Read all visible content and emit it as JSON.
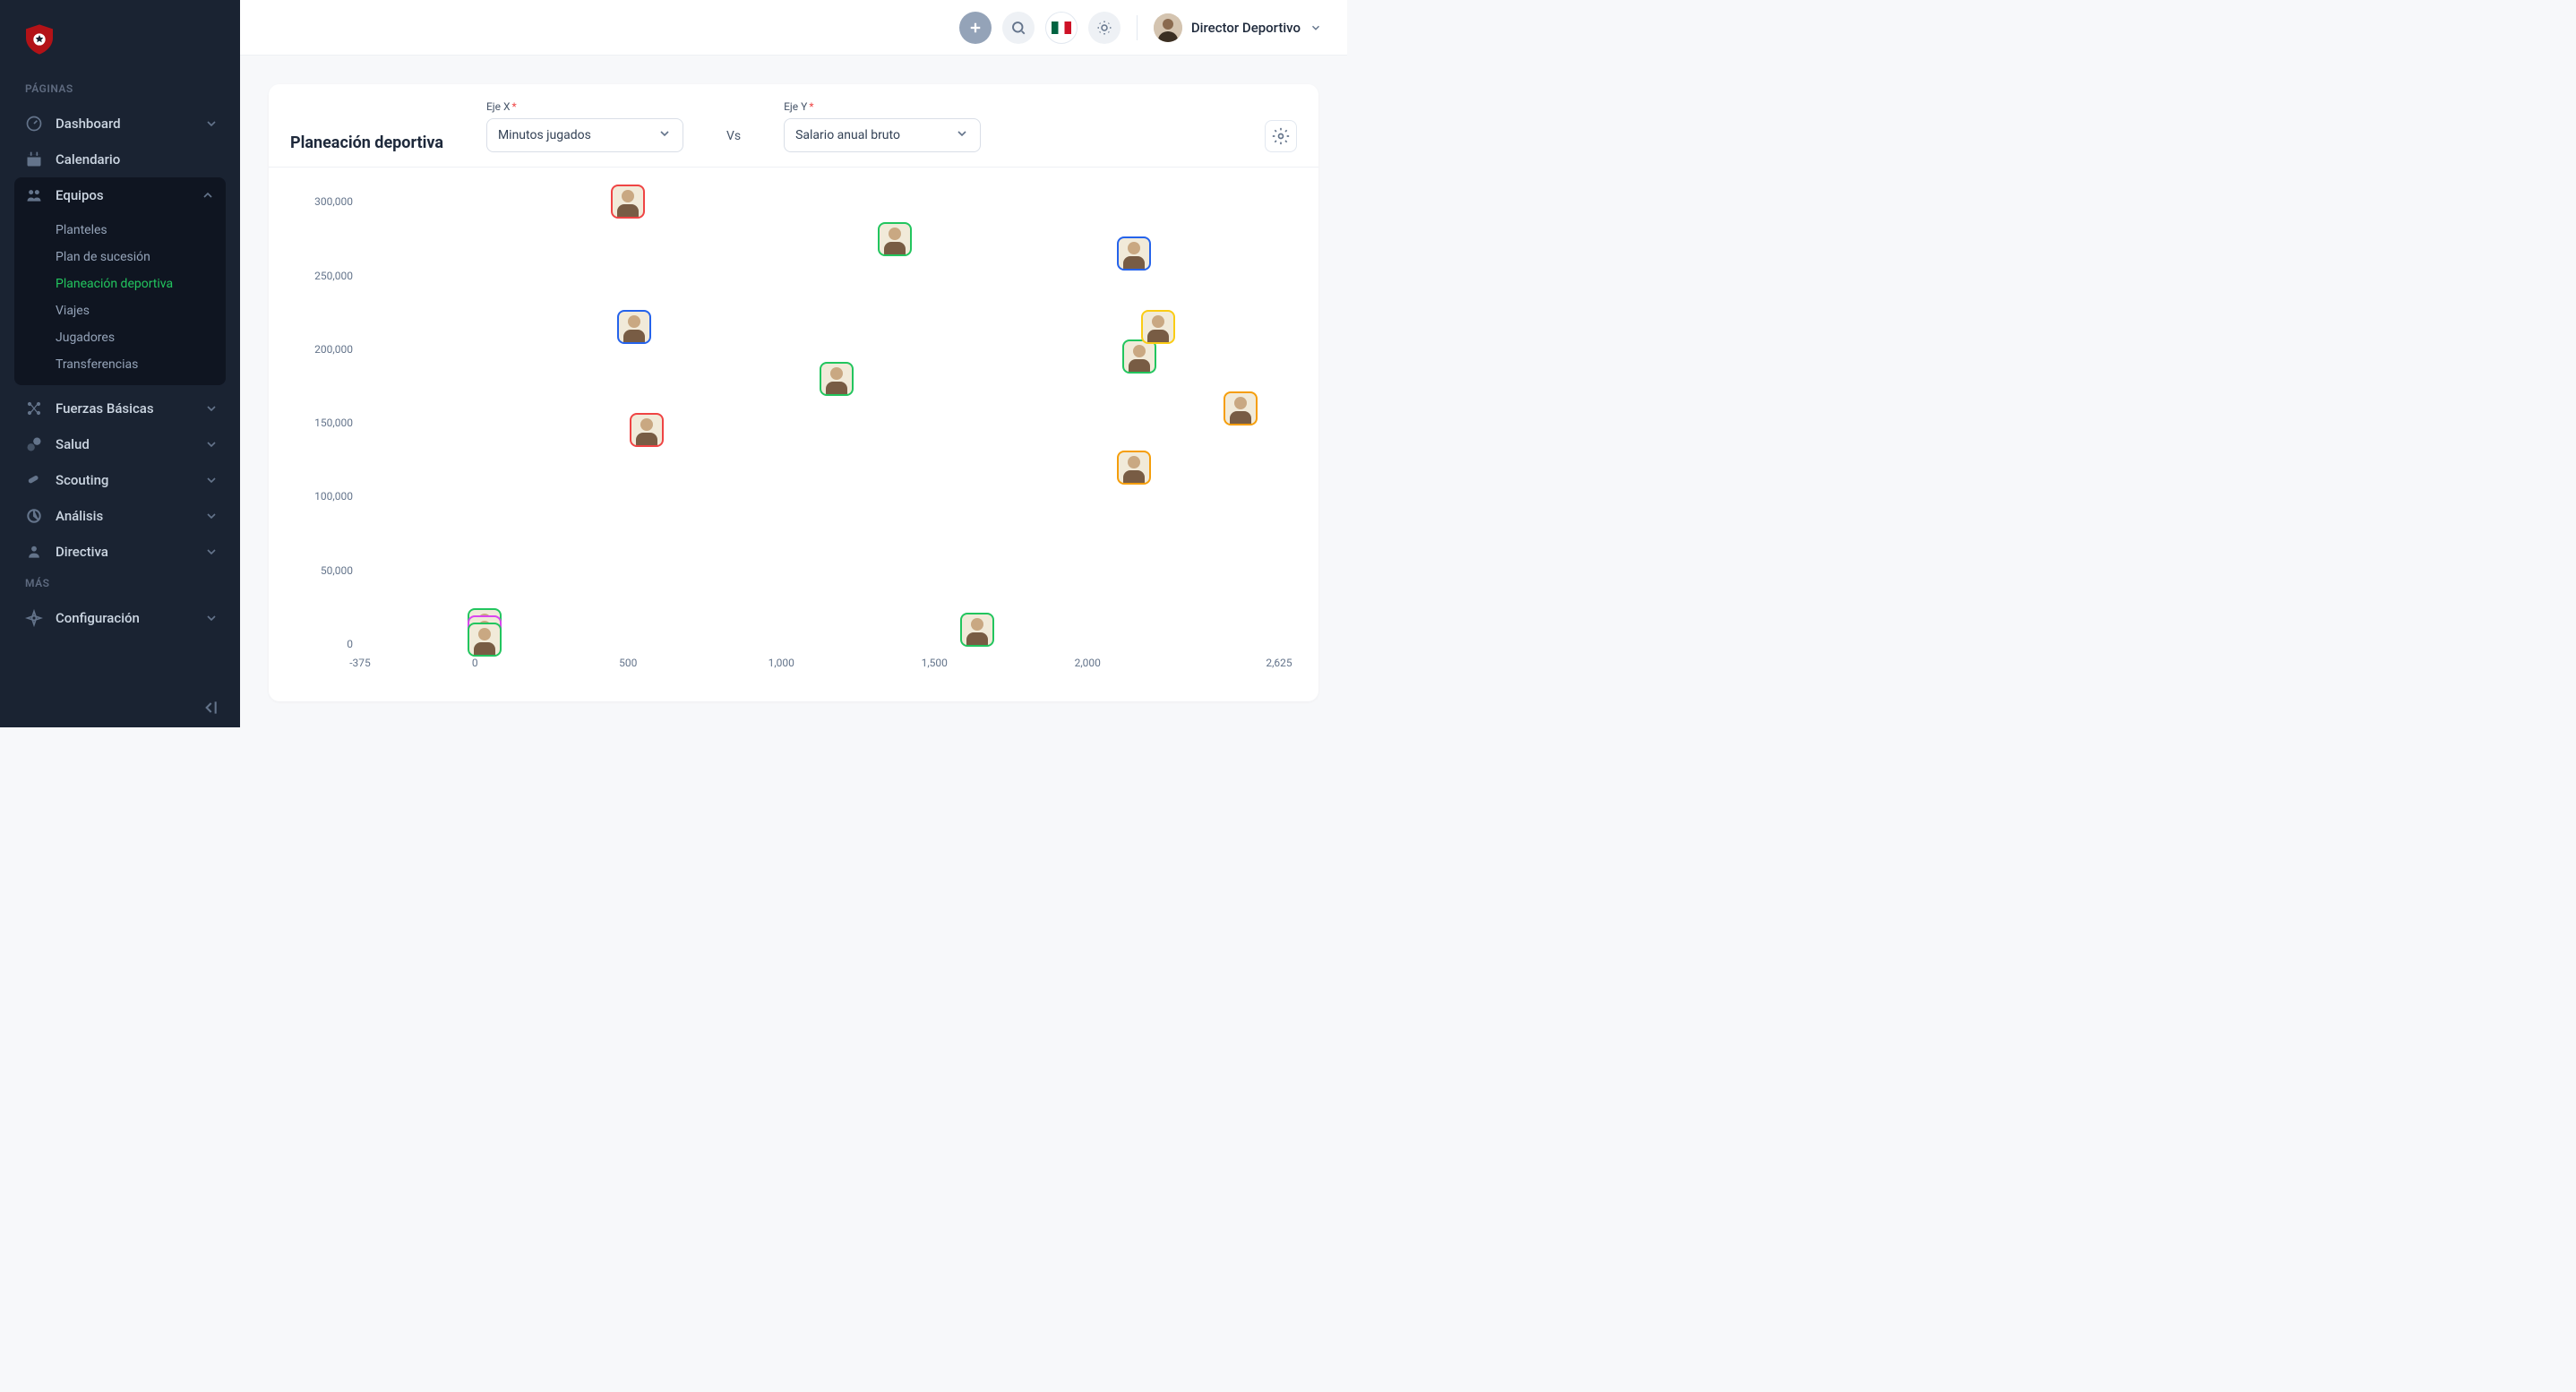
{
  "sidebar": {
    "section_label_1": "PÁGINAS",
    "section_label_2": "MÁS",
    "items": [
      {
        "label": "Dashboard",
        "icon": "gauge-icon",
        "expandable": true
      },
      {
        "label": "Calendario",
        "icon": "calendar-icon",
        "expandable": false
      },
      {
        "label": "Equipos",
        "icon": "users-icon",
        "expandable": true,
        "expanded": true,
        "children": [
          {
            "label": "Planteles"
          },
          {
            "label": "Plan de sucesión"
          },
          {
            "label": "Planeación deportiva",
            "active": true
          },
          {
            "label": "Viajes"
          },
          {
            "label": "Jugadores"
          },
          {
            "label": "Transferencias"
          }
        ]
      },
      {
        "label": "Fuerzas Básicas",
        "icon": "network-icon",
        "expandable": true
      },
      {
        "label": "Salud",
        "icon": "pill-icon",
        "expandable": true
      },
      {
        "label": "Scouting",
        "icon": "telescope-icon",
        "expandable": true
      },
      {
        "label": "Análisis",
        "icon": "pie-icon",
        "expandable": true
      },
      {
        "label": "Directiva",
        "icon": "person-icon",
        "expandable": true
      }
    ],
    "more_items": [
      {
        "label": "Configuración",
        "icon": "compass-icon",
        "expandable": true
      }
    ]
  },
  "topbar": {
    "user_role": "Director Deportivo"
  },
  "page": {
    "title": "Planeación deportiva",
    "x_label": "Eje X",
    "y_label": "Eje Y",
    "x_value": "Minutos jugados",
    "y_value": "Salario anual bruto",
    "vs": "Vs"
  },
  "chart_data": {
    "type": "scatter",
    "xlabel": "Minutos jugados",
    "ylabel": "Salario anual bruto",
    "xlim": [
      -375,
      2625
    ],
    "ylim": [
      0,
      310000
    ],
    "x_ticks": [
      -375,
      0,
      500,
      1000,
      1500,
      2000,
      2625
    ],
    "x_tick_labels": [
      "-375",
      "0",
      "500",
      "1,000",
      "1,500",
      "2,000",
      "2,625"
    ],
    "y_ticks": [
      0,
      50000,
      100000,
      150000,
      200000,
      250000,
      300000
    ],
    "y_tick_labels": [
      "0",
      "50,000",
      "100,000",
      "150,000",
      "200,000",
      "250,000",
      "300,000"
    ],
    "points": [
      {
        "x": 500,
        "y": 300000,
        "color": "red"
      },
      {
        "x": 520,
        "y": 215000,
        "color": "blue"
      },
      {
        "x": 560,
        "y": 145000,
        "color": "red"
      },
      {
        "x": 1180,
        "y": 180000,
        "color": "green"
      },
      {
        "x": 1370,
        "y": 275000,
        "color": "green"
      },
      {
        "x": 1640,
        "y": 10000,
        "color": "green"
      },
      {
        "x": 2150,
        "y": 265000,
        "color": "blue"
      },
      {
        "x": 2170,
        "y": 195000,
        "color": "green"
      },
      {
        "x": 2230,
        "y": 215000,
        "color": "yellow"
      },
      {
        "x": 2150,
        "y": 120000,
        "color": "orange"
      },
      {
        "x": 2500,
        "y": 160000,
        "color": "orange"
      },
      {
        "x": 30,
        "y": 13000,
        "color": "green"
      },
      {
        "x": 30,
        "y": 8000,
        "color": "magenta"
      },
      {
        "x": 30,
        "y": 3000,
        "color": "green"
      }
    ]
  }
}
